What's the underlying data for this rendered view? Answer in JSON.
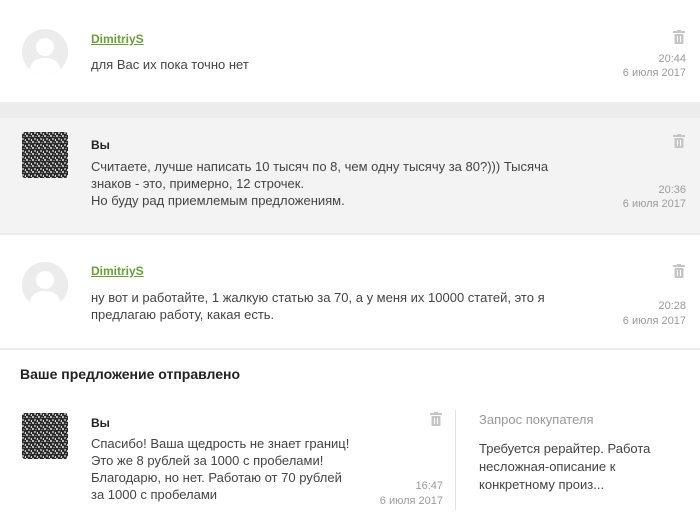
{
  "messages": [
    {
      "author": "DimitriyS",
      "text": "для Вас их пока точно нет",
      "time": "20:44",
      "date": "6 июля 2017"
    },
    {
      "author": "Вы",
      "text_lines": [
        "Считаете, лучше написать 10 тысяч по 8, чем одну тысячу за 80?))) Тысяча",
        "знаков - это, примерно, 12 строчек.",
        "Но буду рад приемлемым предложениям."
      ],
      "time": "20:36",
      "date": "6 июля 2017"
    },
    {
      "author": "DimitriyS",
      "text_lines": [
        "ну вот и работайте, 1 жалкую статью за 70, а у меня их 10000 статей, это я",
        "предлагаю работу, какая есть."
      ],
      "time": "20:28",
      "date": "6 июля 2017"
    }
  ],
  "offer": {
    "title": "Ваше предложение отправлено",
    "message": {
      "author": "Вы",
      "text_lines": [
        "Спасибо! Ваша щедрость не знает границ!",
        "Это же 8 рублей за 1000 с пробелами!",
        "Благодарю, но нет. Работаю от 70 рублей",
        "за 1000 с пробелами"
      ],
      "time": "16:47",
      "date": "6 июля 2017"
    },
    "request": {
      "title": "Запрос покупателя",
      "text_lines": [
        "Требуется рерайтер. Работа",
        "несложная-описание к",
        "конкретному произ..."
      ]
    }
  },
  "icons": {
    "user_avatar": "user-placeholder-icon",
    "self_avatar": "noise-avatar",
    "delete": "trash-icon"
  },
  "colors": {
    "author_link": "#6a9e3b",
    "muted": "#9b9b9b",
    "alt_background": "#f3f3f3"
  }
}
